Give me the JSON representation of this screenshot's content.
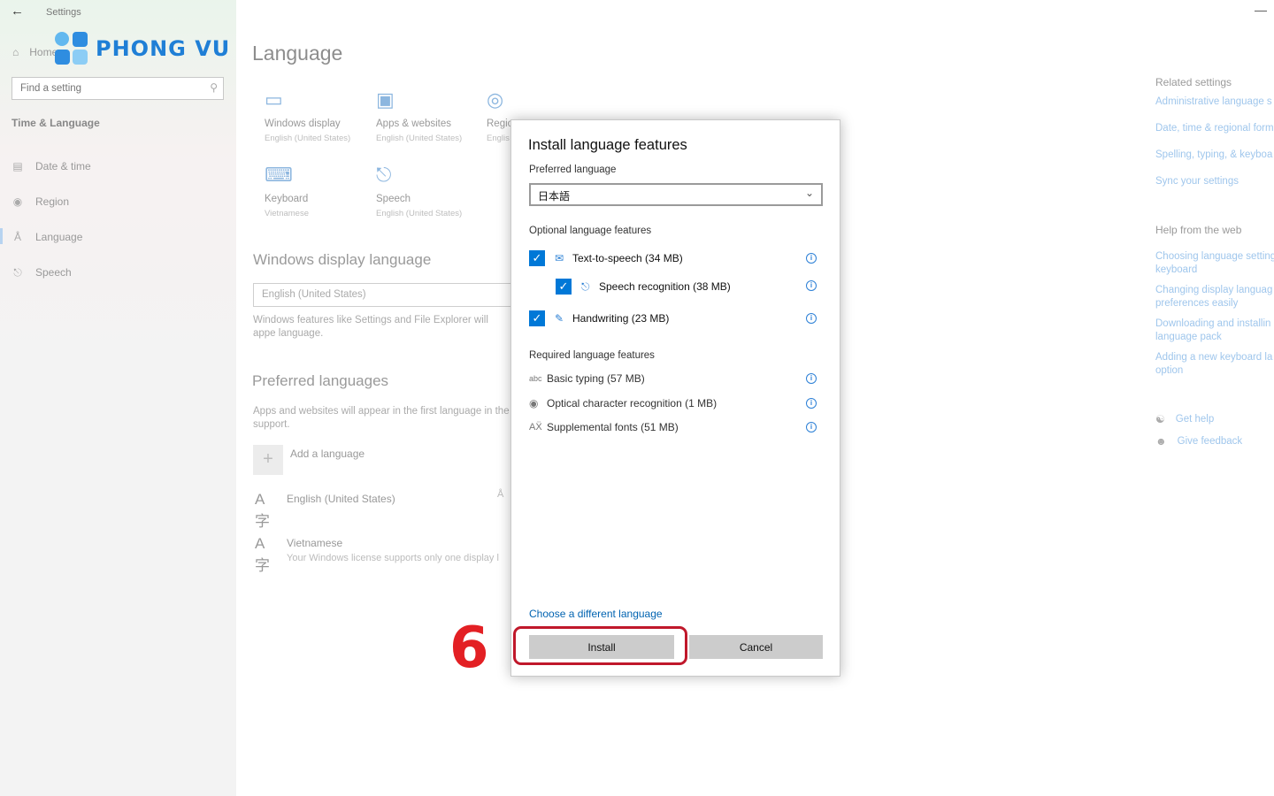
{
  "window": {
    "title": "Settings",
    "minimize_glyph": "—"
  },
  "watermark": {
    "text": "PHONG VU"
  },
  "sidebar": {
    "home_label": "Home",
    "search_placeholder": "Find a setting",
    "section_title": "Time & Language",
    "items": [
      {
        "label": "Date & time",
        "icon": "calendar-clock-icon"
      },
      {
        "label": "Region",
        "icon": "globe-icon"
      },
      {
        "label": "Language",
        "icon": "language-icon",
        "active": true
      },
      {
        "label": "Speech",
        "icon": "microphone-icon"
      }
    ]
  },
  "main": {
    "title": "Language",
    "tiles": [
      {
        "name": "Windows display",
        "sub": "English (United States)",
        "icon": "laptop-icon"
      },
      {
        "name": "Apps & websites",
        "sub": "English (United States)",
        "icon": "window-icon"
      },
      {
        "name": "Regio",
        "sub": "Englis",
        "icon": "globe-icon"
      },
      {
        "name": "Keyboard",
        "sub": "Vietnamese",
        "icon": "keyboard-icon"
      },
      {
        "name": "Speech",
        "sub": "English (United States)",
        "icon": "microphone-icon"
      }
    ],
    "display_language": {
      "heading": "Windows display language",
      "value": "English (United States)",
      "description": "Windows features like Settings and File Explorer will appe language."
    },
    "preferred": {
      "heading": "Preferred languages",
      "description": "Apps and websites will appear in the first language in the support.",
      "add_label": "Add a language",
      "languages": [
        {
          "name": "English (United States)",
          "sub": ""
        },
        {
          "name": "Vietnamese",
          "sub": "Your Windows license supports only one display l"
        }
      ]
    }
  },
  "related": {
    "heading": "Related settings",
    "links": [
      "Administrative language s",
      "Date, time & regional form",
      "Spelling, typing, & keyboa",
      "Sync your settings"
    ],
    "web_heading": "Help from the web",
    "web_links": [
      [
        "Choosing language setting",
        "keyboard"
      ],
      [
        "Changing display languag",
        "preferences easily"
      ],
      [
        "Downloading and installin",
        "language pack"
      ],
      [
        "Adding a new keyboard la",
        "option"
      ]
    ],
    "get_help": "Get help",
    "give_feedback": "Give feedback"
  },
  "dialog": {
    "title": "Install language features",
    "preferred_label": "Preferred language",
    "preferred_value": "日本語",
    "optional_heading": "Optional language features",
    "optional": [
      {
        "label": "Text-to-speech (34 MB)",
        "checked": true,
        "icon": "tts-icon"
      },
      {
        "label": "Speech recognition (38 MB)",
        "checked": true,
        "icon": "microphone-icon"
      },
      {
        "label": "Handwriting (23 MB)",
        "checked": true,
        "icon": "pen-icon"
      }
    ],
    "required_heading": "Required language features",
    "required": [
      {
        "label": "Basic typing (57 MB)",
        "icon": "abc-icon"
      },
      {
        "label": "Optical character recognition (1 MB)",
        "icon": "ocr-icon"
      },
      {
        "label": "Supplemental fonts (51 MB)",
        "icon": "font-icon"
      }
    ],
    "choose_link": "Choose a different language",
    "install_label": "Install",
    "cancel_label": "Cancel"
  },
  "annotation": {
    "step": "6",
    "color": "#e32024"
  }
}
